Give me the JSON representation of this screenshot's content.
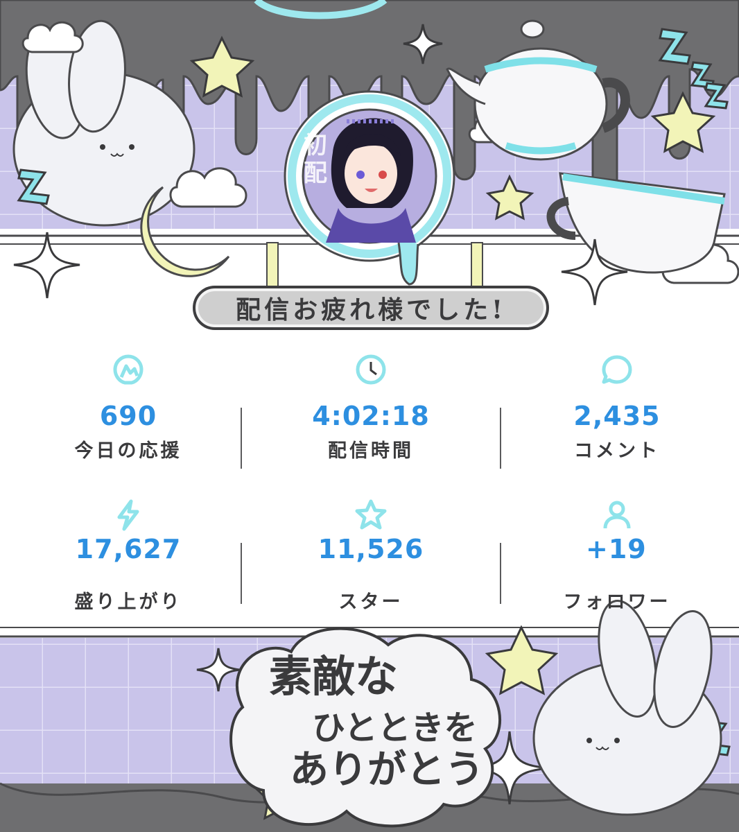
{
  "banner": {
    "title": "配信お疲れ様でした!"
  },
  "stats": [
    {
      "value": "690",
      "label": "今日の応援",
      "icon": "cheer-icon"
    },
    {
      "value": "4:02:18",
      "label": "配信時間",
      "icon": "clock-icon"
    },
    {
      "value": "2,435",
      "label": "コメント",
      "icon": "comment-icon"
    },
    {
      "value": "17,627",
      "label": "盛り上がり",
      "icon": "lightning-icon"
    },
    {
      "value": "11,526",
      "label": "スター",
      "icon": "star-icon"
    },
    {
      "value": "+19",
      "label": "フォロワー",
      "icon": "person-icon"
    }
  ],
  "thanks": {
    "line1": "素敵な",
    "line2": "ひとときを",
    "line3": "ありがとう"
  },
  "avatar": {
    "side_text_1": "初",
    "side_text_2": "配"
  },
  "colors": {
    "accent_cyan": "#7fe0e8",
    "value_blue": "#2d8fe0",
    "lavender": "#c9c4ea",
    "star_yellow": "#f2f4b8",
    "dark_gray": "#3a3a3c"
  }
}
